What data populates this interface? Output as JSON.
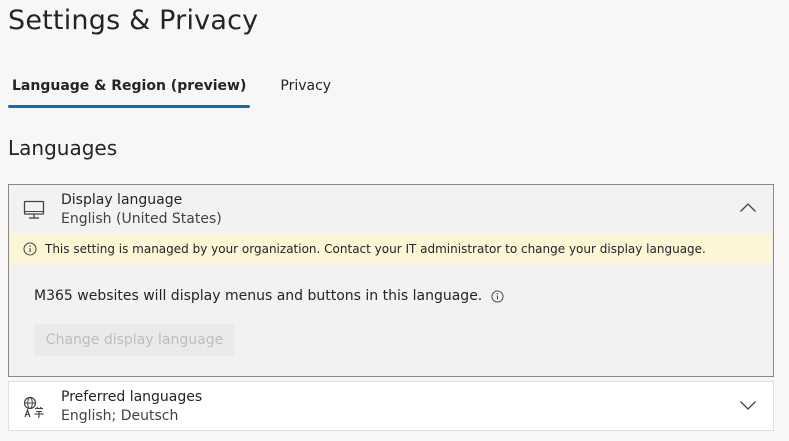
{
  "page": {
    "title": "Settings & Privacy"
  },
  "tabs": [
    {
      "label": "Language & Region (preview)",
      "active": true
    },
    {
      "label": "Privacy",
      "active": false
    }
  ],
  "languages": {
    "section_title": "Languages",
    "display_language": {
      "icon": "monitor-icon",
      "title": "Display language",
      "value": "English (United States)",
      "expanded": true,
      "banner_text": "This setting is managed by your organization. Contact your IT administrator to change your display language.",
      "description": "M365 websites will display menus and buttons in this language.",
      "button_label": "Change display language",
      "button_disabled": true
    },
    "preferred_languages": {
      "icon": "translate-icon",
      "title": "Preferred languages",
      "value": "English; Deutsch",
      "expanded": false
    }
  },
  "colors": {
    "accent": "#0f6cbd",
    "banner_bg": "#fdf6d5"
  }
}
